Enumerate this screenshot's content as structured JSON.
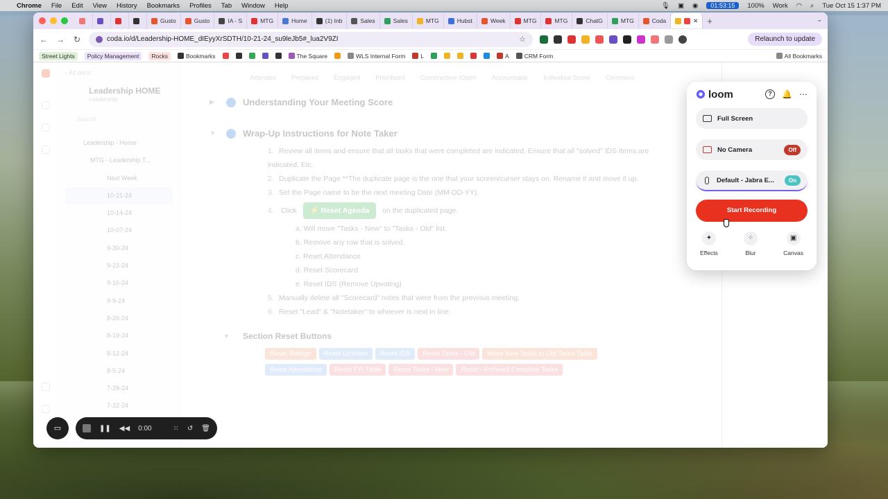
{
  "menubar": {
    "app": "Chrome",
    "items": [
      "File",
      "Edit",
      "View",
      "History",
      "Bookmarks",
      "Profiles",
      "Tab",
      "Window",
      "Help"
    ],
    "timer": "01:53:15",
    "battery": "100%",
    "focus": "Work",
    "datetime": "Tue Oct 15  1:37 PM"
  },
  "tabs": [
    {
      "label": "",
      "color": "#e77"
    },
    {
      "label": "",
      "color": "#6a4fc2"
    },
    {
      "label": "",
      "color": "#d33"
    },
    {
      "label": "",
      "color": "#333"
    },
    {
      "label": "Gusto",
      "color": "#e4572e"
    },
    {
      "label": "Gusto",
      "color": "#e4572e"
    },
    {
      "label": "IA - S",
      "color": "#444"
    },
    {
      "label": "MTG",
      "color": "#d33"
    },
    {
      "label": "Home",
      "color": "#4a7bd0"
    },
    {
      "label": "(1) Inb",
      "color": "#333"
    },
    {
      "label": "Sales",
      "color": "#555"
    },
    {
      "label": "Sales",
      "color": "#2e9e5b"
    },
    {
      "label": "MTG",
      "color": "#f0b429"
    },
    {
      "label": "Hubst",
      "color": "#3f6fd8"
    },
    {
      "label": "Week",
      "color": "#e4572e"
    },
    {
      "label": "MTG",
      "color": "#d33"
    },
    {
      "label": "MTG",
      "color": "#d33"
    },
    {
      "label": "ChatG",
      "color": "#333"
    },
    {
      "label": "MTG",
      "color": "#2e9e5b"
    },
    {
      "label": "Coda",
      "color": "#e4572e"
    }
  ],
  "address": {
    "url": "coda.io/d/Leadership-HOME_dIEyyXrSDTH/10-21-24_su9leJb5#_lua2V9ZI",
    "relaunch": "Relaunch to update"
  },
  "bookmarks": {
    "chips": [
      {
        "label": "Street Lights",
        "bg": "#dff1d9"
      },
      {
        "label": "Policy Management",
        "bg": "#ece2fb"
      },
      {
        "label": "Rocks",
        "bg": "#fde2e2"
      }
    ],
    "items": [
      "Bookmarks",
      "The Square",
      "WLS Internal Form",
      "L",
      "A",
      "CRM Form"
    ],
    "all": "All Bookmarks"
  },
  "sidebar": {
    "all_docs": "All docs",
    "doc_title": "Leadership HOME",
    "doc_sub": "Leadership",
    "search_placeholder": "Search",
    "items": [
      {
        "label": "Leadership - Home",
        "level": "l1"
      },
      {
        "label": "MTG - Leadership T...",
        "level": "l2"
      },
      {
        "label": "Next Week",
        "level": "l3"
      },
      {
        "label": "10-21-24",
        "level": "l3",
        "selected": true
      },
      {
        "label": "10-14-24",
        "level": "l3"
      },
      {
        "label": "10-07-24",
        "level": "l3"
      },
      {
        "label": "9-30-24",
        "level": "l3"
      },
      {
        "label": "9-23-24",
        "level": "l3"
      },
      {
        "label": "9-16-24",
        "level": "l3"
      },
      {
        "label": "9-9-24",
        "level": "l3"
      },
      {
        "label": "8-26-24",
        "level": "l3"
      },
      {
        "label": "8-19-24",
        "level": "l3"
      },
      {
        "label": "8-12-24",
        "level": "l3"
      },
      {
        "label": "8-5-24",
        "level": "l3"
      },
      {
        "label": "7-29-24",
        "level": "l3"
      },
      {
        "label": "7-22-24",
        "level": "l3"
      }
    ]
  },
  "table_header": [
    "Attendee",
    "Prepared",
    "Engaged",
    "Prioritized",
    "Constructive /Open",
    "Accountable",
    "Individual Score",
    "Comment"
  ],
  "doc": {
    "section1": "Understanding Your Meeting Score",
    "section2": "Wrap-Up Instructions for Note Taker",
    "steps": [
      {
        "n": "1.",
        "text": "Review all items and ensure that all tasks that were completed are indicated.  Ensure that all \"solved\" IDS items are indicated. Etc."
      },
      {
        "n": "2.",
        "text": "Duplicate the Page **The duplicate page is the one that your screen/curser stays on.  Rename it and move it up."
      },
      {
        "n": "3.",
        "text": "Set the Page name to be the next meeting Date (MM-DD-YY)."
      }
    ],
    "step4_prefix": "Click",
    "step4_button": "⚡ Reset Agenda",
    "step4_suffix": "on the duplicated page.",
    "substeps": [
      "a.   Will move \"Tasks - New\" to \"Tasks - Old\" list.",
      "b.   Remove any row that is solved.",
      "c.   Reset Attendance",
      "d.   Reset Scorecard",
      "e.   Reset IDS (Remove Upvoting)"
    ],
    "steps_tail": [
      {
        "n": "5.",
        "text": "Manually delete all \"Scorecard\" notes that were from the previous meeting."
      },
      {
        "n": "6.",
        "text": "Reset \"Lead\" & \"Notetaker\" to whoever is next in line."
      }
    ],
    "section3": "Section Reset Buttons",
    "buttons_row1": [
      {
        "label": "Reset Ratings",
        "color": "#ef9f7a"
      },
      {
        "label": "Reset UpVotes",
        "color": "#8fb8ec"
      },
      {
        "label": "Reset IDS",
        "color": "#8fb8ec"
      },
      {
        "label": "Reset Tasks - Old",
        "color": "#ec8f8f"
      },
      {
        "label": "Move New Tasks to Old Tasks Table",
        "color": "#ef9f7a"
      }
    ],
    "buttons_row2": [
      {
        "label": "Reset Attendance",
        "color": "#8fb8ec"
      },
      {
        "label": "Reset FYI Table",
        "color": "#ec8f8f"
      },
      {
        "label": "Reset Tasks - New",
        "color": "#ec8f8f"
      },
      {
        "label": "Reset - Archived Complete Tasks",
        "color": "#ec8f8f"
      }
    ]
  },
  "loom": {
    "logo": "loom",
    "full_screen": "Full Screen",
    "no_camera": "No Camera",
    "camera_state": "Off",
    "mic": "Default - Jabra E...",
    "mic_state": "On",
    "start": "Start Recording",
    "tools": [
      "Effects",
      "Blur",
      "Canvas"
    ]
  },
  "recorder": {
    "time": "0:00"
  }
}
